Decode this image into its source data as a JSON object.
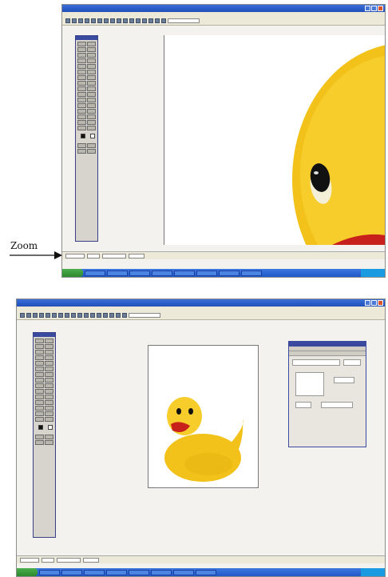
{
  "caption": {
    "zoom_label": "Zoom"
  },
  "top_window": {
    "window_buttons": [
      "minimize",
      "maximize",
      "close"
    ]
  },
  "bottom_window": {
    "window_buttons": [
      "minimize",
      "maximize",
      "close"
    ]
  },
  "icons": {
    "zoom_arrow": "right-arrow-icon",
    "tools": "tool-icon",
    "duck": "rubber-duck-image"
  },
  "colors": {
    "title_bar": "#2a5cc8",
    "taskbar": "#2a62d4",
    "start_button": "#3a9a3a",
    "duck_yellow": "#f2c21a",
    "duck_beak": "#c8201a",
    "toolbox_border": "#3a3f8a"
  }
}
